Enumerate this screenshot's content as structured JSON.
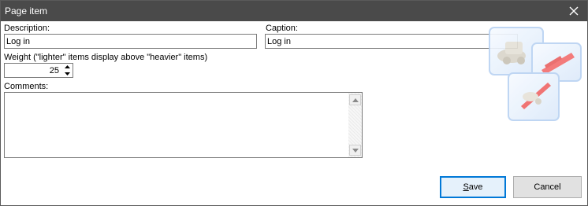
{
  "window": {
    "title": "Page item",
    "close_icon": "close-icon"
  },
  "form": {
    "description_label": "Description:",
    "description_value": "Log in",
    "caption_label": "Caption:",
    "caption_value": "Log in",
    "weight_label": "Weight (\"lighter\" items display above \"heavier\" items)",
    "weight_value": "25",
    "comments_label": "Comments:",
    "comments_value": ""
  },
  "buttons": {
    "save_label": "Save",
    "cancel_label": "Cancel"
  },
  "icons": {
    "decoration": "page-items-illustration-icon",
    "spin_up": "spin-up-icon",
    "spin_down": "spin-down-icon",
    "scroll_up": "scroll-up-icon",
    "scroll_down": "scroll-down-icon"
  },
  "colors": {
    "titlebar": "#4a4a4a",
    "accent": "#0078d7"
  }
}
